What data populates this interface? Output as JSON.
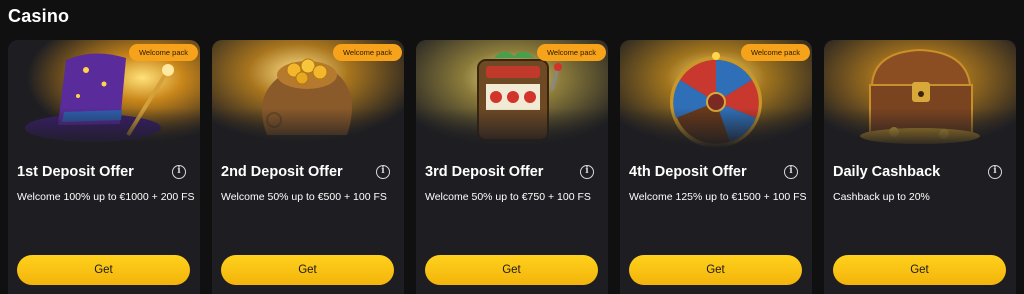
{
  "section": {
    "title": "Casino"
  },
  "cards": [
    {
      "title": "1st Deposit Offer",
      "description": "Welcome 100% up to €1000 + 200 FS",
      "badge": "Welcome pack",
      "button": "Get",
      "art_icon": "wizard-hat-icon"
    },
    {
      "title": "2nd Deposit Offer",
      "description": "Welcome 50% up to €500 + 100 FS",
      "badge": "Welcome pack",
      "button": "Get",
      "art_icon": "coin-sack-icon"
    },
    {
      "title": "3rd Deposit Offer",
      "description": "Welcome 50% up to €750 + 100 FS",
      "badge": "Welcome pack",
      "button": "Get",
      "art_icon": "slot-machine-icon"
    },
    {
      "title": "4th Deposit Offer",
      "description": "Welcome 125% up to €1500 + 100 FS",
      "badge": "Welcome pack",
      "button": "Get",
      "art_icon": "prize-wheel-icon"
    },
    {
      "title": "Daily Cashback",
      "description": "Cashback up to 20%",
      "button": "Get",
      "art_icon": "treasure-chest-icon"
    }
  ],
  "colors": {
    "page_background": "#101010",
    "card_background": "#1e1e22",
    "badge": "#f6a21b",
    "button": "#ffc814"
  }
}
